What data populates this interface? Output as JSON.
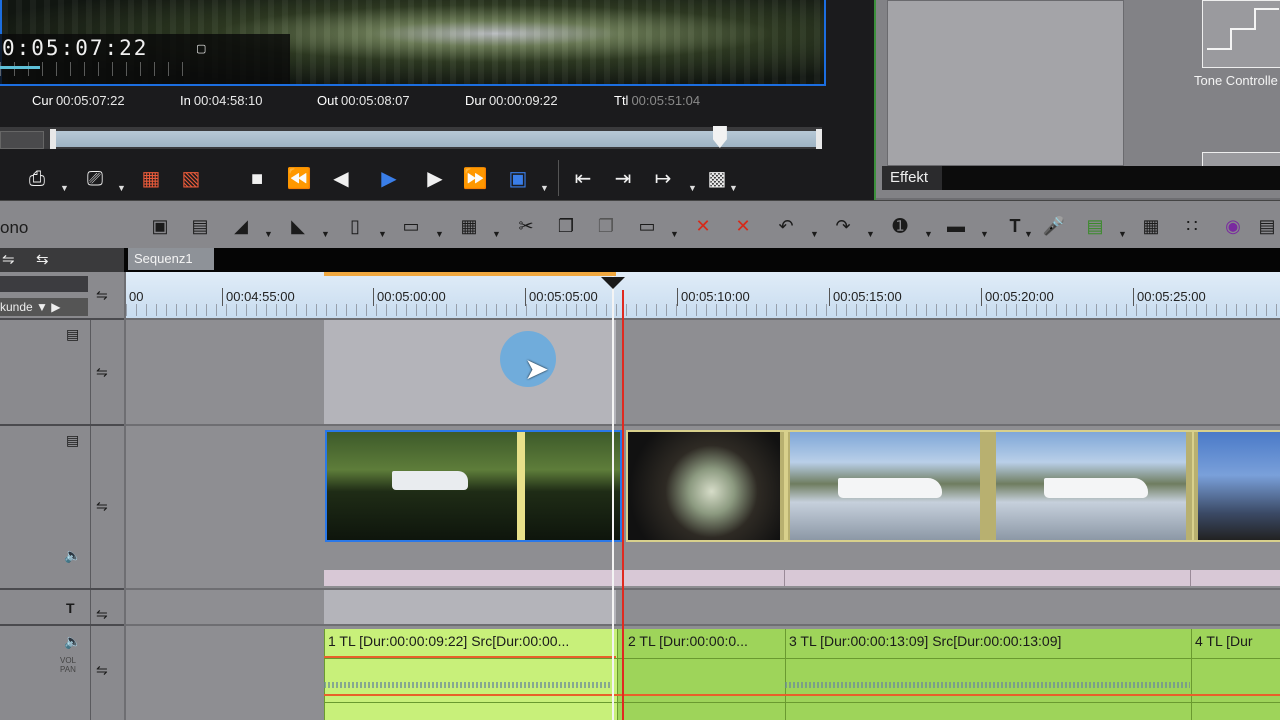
{
  "recorder": {
    "timecode": "0:05:07:22",
    "cur_label": "Cur",
    "cur": "00:05:07:22",
    "in_label": "In",
    "in": "00:04:58:10",
    "out_label": "Out",
    "out": "00:05:08:07",
    "dur_label": "Dur",
    "dur": "00:00:09:22",
    "ttl_label": "Ttl",
    "ttl": "00:05:51:04",
    "scrub_position": 0.87,
    "transport_icons": [
      "set-in-icon",
      "set-out-icon",
      "clear-in-icon",
      "clear-out-icon",
      "stop-icon",
      "rewind-icon",
      "step-back-icon",
      "play-icon",
      "step-forward-icon",
      "fast-forward-icon",
      "loop-icon",
      "prev-edit-icon",
      "next-edit-icon",
      "insert-icon",
      "overwrite-icon"
    ]
  },
  "effect_panel": {
    "tone_label": "Tone Controlle",
    "tab": "Effekt"
  },
  "timeline": {
    "mono_label": "ono",
    "sequence_tab": "Sequenz1",
    "unit_label": "kunde",
    "ruler": [
      "00",
      "00:04:55:00",
      "00:05:00:00",
      "00:05:05:00",
      "00:05:10:00",
      "00:05:15:00",
      "00:05:20:00",
      "00:05:25:00"
    ],
    "audio_clips": [
      {
        "label": "1  TL [Dur:00:00:09:22]  Src[Dur:00:00..."
      },
      {
        "label": "2  TL [Dur:00:00:0..."
      },
      {
        "label": "3  TL [Dur:00:00:13:09]  Src[Dur:00:00:13:09]"
      },
      {
        "label": "4  TL [Dur"
      }
    ],
    "vol_pan_label": "VOL PAN",
    "title_track_icon": "T"
  }
}
